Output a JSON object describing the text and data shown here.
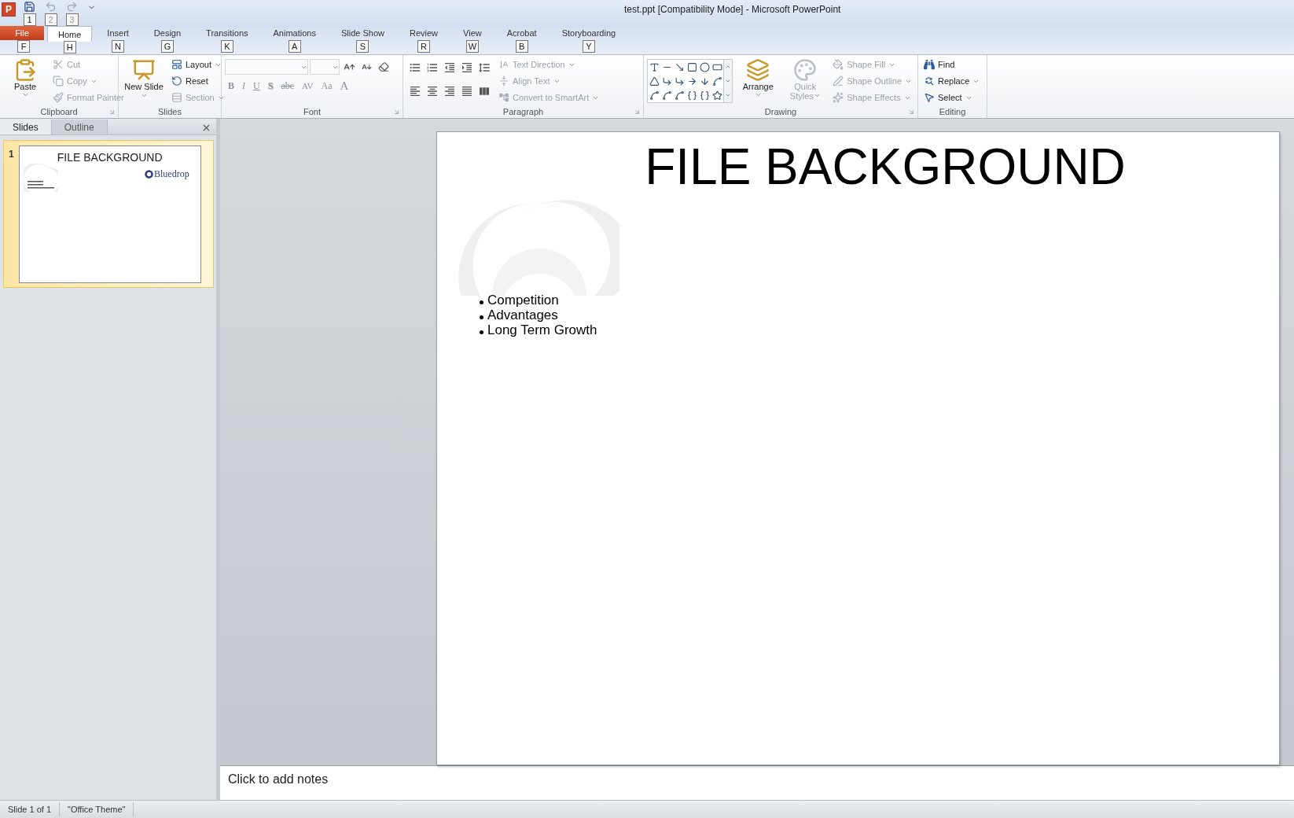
{
  "window": {
    "app_icon": "P",
    "title": "test.ppt [Compatibility Mode]  -  Microsoft PowerPoint"
  },
  "quick_access": [
    {
      "kind": "save",
      "keytip": "1",
      "disabled": false
    },
    {
      "kind": "undo",
      "keytip": "2",
      "disabled": true
    },
    {
      "kind": "redo",
      "keytip": "3",
      "disabled": true
    }
  ],
  "tabs": [
    {
      "label": "File",
      "keytip": "F",
      "kind": "file",
      "selected": false
    },
    {
      "label": "Home",
      "keytip": "H",
      "kind": "tab",
      "selected": true
    },
    {
      "label": "Insert",
      "keytip": "N",
      "kind": "tab",
      "selected": false
    },
    {
      "label": "Design",
      "keytip": "G",
      "kind": "tab",
      "selected": false
    },
    {
      "label": "Transitions",
      "keytip": "K",
      "kind": "tab",
      "selected": false
    },
    {
      "label": "Animations",
      "keytip": "A",
      "kind": "tab",
      "selected": false
    },
    {
      "label": "Slide Show",
      "keytip": "S",
      "kind": "tab",
      "selected": false
    },
    {
      "label": "Review",
      "keytip": "R",
      "kind": "tab",
      "selected": false
    },
    {
      "label": "View",
      "keytip": "W",
      "kind": "tab",
      "selected": false
    },
    {
      "label": "Acrobat",
      "keytip": "B",
      "kind": "tab",
      "selected": false
    },
    {
      "label": "Storyboarding",
      "keytip": "Y",
      "kind": "tab",
      "selected": false
    }
  ],
  "ribbon": [
    {
      "kind": "clipboard",
      "label": "Clipboard",
      "launcher": true,
      "large": [
        {
          "kind": "paste",
          "label": "Paste",
          "dropdown": true,
          "disabled": false
        }
      ],
      "commands": [
        {
          "kind": "cut",
          "label": "Cut",
          "dropdown": false,
          "disabled": true
        },
        {
          "kind": "copy",
          "label": "Copy",
          "dropdown": true,
          "disabled": true
        },
        {
          "kind": "painter",
          "label": "Format Painter",
          "dropdown": false,
          "disabled": true
        }
      ]
    },
    {
      "kind": "slides",
      "label": "Slides",
      "launcher": false,
      "large": [
        {
          "kind": "newslide",
          "label": "New Slide",
          "dropdown": true,
          "disabled": false
        }
      ],
      "commands": [
        {
          "kind": "layout",
          "label": "Layout",
          "dropdown": true,
          "disabled": false
        },
        {
          "kind": "reset",
          "label": "Reset",
          "dropdown": false,
          "disabled": false
        },
        {
          "kind": "section",
          "label": "Section",
          "dropdown": true,
          "disabled": true
        }
      ]
    },
    {
      "kind": "font",
      "label": "Font",
      "launcher": true,
      "format": [
        {
          "kind": "bold",
          "label": "B",
          "disabled": true
        },
        {
          "kind": "italic",
          "label": "I",
          "disabled": true
        },
        {
          "kind": "underline",
          "label": "U",
          "disabled": true
        },
        {
          "kind": "shadow",
          "label": "S",
          "disabled": true
        },
        {
          "kind": "strike",
          "label": "abc",
          "disabled": true
        },
        {
          "kind": "spacing",
          "label": "AV",
          "disabled": true
        },
        {
          "kind": "case",
          "label": "Aa",
          "disabled": true
        },
        {
          "kind": "color",
          "label": "A",
          "disabled": true
        }
      ]
    },
    {
      "kind": "paragraph",
      "label": "Paragraph",
      "launcher": true,
      "commands": [
        {
          "kind": "direction",
          "label": "Text Direction",
          "dropdown": true,
          "disabled": true
        },
        {
          "kind": "align",
          "label": "Align Text",
          "dropdown": true,
          "disabled": true
        },
        {
          "kind": "smartart",
          "label": "Convert to SmartArt",
          "dropdown": true,
          "disabled": true
        }
      ]
    },
    {
      "kind": "drawing",
      "label": "Drawing",
      "launcher": true,
      "large": [
        {
          "kind": "arrange",
          "label": "Arrange",
          "dropdown": true,
          "disabled": false
        },
        {
          "kind": "styles",
          "label": "Quick Styles",
          "dropdown": true,
          "disabled": true
        }
      ],
      "commands": [
        {
          "kind": "fill",
          "label": "Shape Fill",
          "dropdown": true,
          "disabled": true
        },
        {
          "kind": "outline",
          "label": "Shape Outline",
          "dropdown": true,
          "disabled": true
        },
        {
          "kind": "effects",
          "label": "Shape Effects",
          "dropdown": true,
          "disabled": true
        }
      ]
    },
    {
      "kind": "editing",
      "label": "Editing",
      "launcher": false,
      "commands": [
        {
          "kind": "find",
          "label": "Find",
          "dropdown": false,
          "disabled": false
        },
        {
          "kind": "replace",
          "label": "Replace",
          "dropdown": true,
          "disabled": false
        },
        {
          "kind": "select",
          "label": "Select",
          "dropdown": true,
          "disabled": false
        }
      ]
    }
  ],
  "pane": {
    "tabs": [
      {
        "label": "Slides",
        "selected": true
      },
      {
        "label": "Outline",
        "selected": false
      }
    ],
    "thumbnails": [
      {
        "number": "1",
        "selected": true,
        "title": "FILE BACKGROUND",
        "logo": "Bluedrop"
      }
    ]
  },
  "slide": {
    "title": "FILE BACKGROUND",
    "bullets": [
      "Competition",
      "Advantages",
      "Long Term Growth"
    ]
  },
  "notes": {
    "placeholder": "Click to add notes"
  },
  "status_bar": {
    "items": [
      "Slide 1 of 1",
      "\"Office Theme\""
    ]
  }
}
